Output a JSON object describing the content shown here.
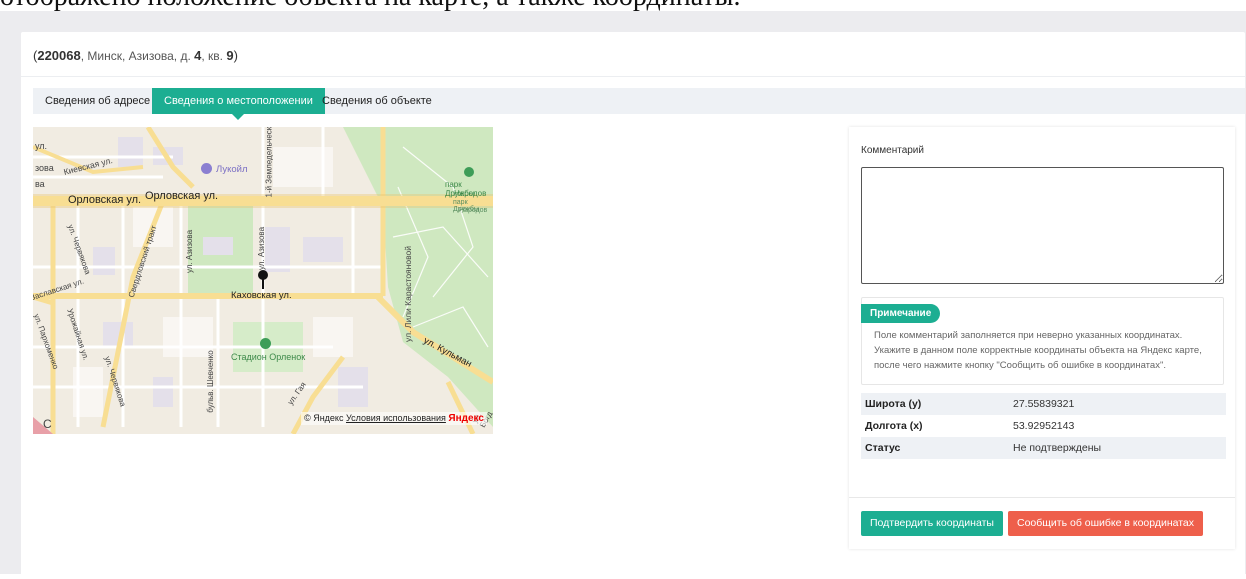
{
  "doc_caption": "отображено положение объекта на карте, а также координаты.",
  "card": {
    "title_open": "(",
    "postcode": "220068",
    "address_part1": ", Минск, Азизова, д. ",
    "house": "4",
    "address_part2": ", кв. ",
    "flat": "9",
    "title_close": ")"
  },
  "tabs": [
    {
      "label": "Сведения об адресе",
      "active": false
    },
    {
      "label": "Сведения о местоположении",
      "active": true
    },
    {
      "label": "Сведения об объекте",
      "active": false
    }
  ],
  "map": {
    "labels": {
      "lukoil": "Лукойл",
      "orlovskaya1": "Орловская ул.",
      "orlovskaya2": "Орловская ул.",
      "kievskaya": "Киевская ул.",
      "zemledel": "1-й Земледельческий",
      "park1": "парк Дружбы",
      "park2": "Народов",
      "park3": "парк Дружбы",
      "park4": "Народов",
      "azizova": "ул. Азизова",
      "kakhovskaya": "Каховская ул.",
      "karastoyanovoy": "ул. Лили Карастояновой",
      "kulman": "ул. Кульман",
      "stadium": "Стадион Орленок",
      "chervyakova1": "ул. Червякова",
      "chervyakova2": "ул. Червякова",
      "sverdlovskiy": "Свердловский тракт",
      "parkhomenko": "ул. Пархоменко",
      "urozhaynaya": "Урожайная ул.",
      "shevchenko": "бульв. Шевченко",
      "gaya": "ул. Гая",
      "zaslavskaya": "Заславская ул.",
      "cut1": "ул.",
      "cut2": "зова",
      "cut3": "ва",
      "cut4": "С",
      "bogd": "ул. Богд"
    },
    "attribution": "© Яндекс",
    "terms_link": "Условия использования",
    "brand": "Яндекс"
  },
  "panel": {
    "comment_label": "Комментарий",
    "comment_value": "",
    "note_badge": "Примечание",
    "note_text": "Поле комментарий заполняется при неверно указанных координатах. Укажите в данном поле корректные координаты объекта на Яндекс карте, после чего нажмите кнопку \"Сообщить об ошибке в координатах\".",
    "rows": [
      {
        "key": "Широта (y)",
        "value": "27.55839321"
      },
      {
        "key": "Долгота (x)",
        "value": "53.92952143"
      },
      {
        "key": "Статус",
        "value": "Не подтверждены"
      }
    ],
    "confirm_button": "Подтвердить координаты",
    "report_button": "Сообщить об ошибке в координатах"
  },
  "colors": {
    "accent": "#1cae92",
    "danger": "#ee5f4b",
    "map_road": "#f8de93",
    "map_park": "#cfe8c0"
  },
  "icons": [
    "lukoil-pin-icon",
    "park-pin-icon",
    "stadium-pin-icon",
    "location-marker-icon"
  ]
}
